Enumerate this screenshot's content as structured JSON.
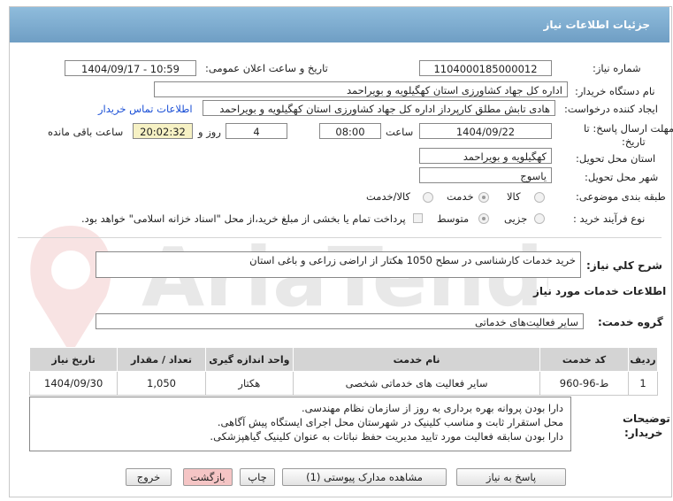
{
  "header": {
    "title": "جزئیات اطلاعات نیاز"
  },
  "need_number": {
    "label": "شماره نیاز:",
    "value": "1104000185000012"
  },
  "announce": {
    "label": "تاریخ و ساعت اعلان عمومی:",
    "value": "1404/09/17 - 10:59"
  },
  "buyer_org": {
    "label": "نام دستگاه خریدار:",
    "value": "اداره کل جهاد کشاورزی استان کهگیلویه و بویراحمد"
  },
  "requester": {
    "label": "ایجاد کننده درخواست:",
    "value": "هادی تابش مطلق کارپرداز اداره کل جهاد کشاورزی استان کهگیلویه و بویراحمد",
    "contact_link": "اطلاعات تماس خریدار"
  },
  "deadline": {
    "label1": "مهلت ارسال پاسخ: تا",
    "label2": "تاریخ:",
    "date": "1404/09/22",
    "time_label": "ساعت",
    "time": "08:00",
    "days": "4",
    "days_label": "روز و",
    "remaining": "20:02:32",
    "remaining_label": "ساعت باقی مانده"
  },
  "province": {
    "label": "استان محل تحویل:",
    "value": "کهگیلویه و بویراحمد"
  },
  "city": {
    "label": "شهر محل تحویل:",
    "value": "یاسوج"
  },
  "category": {
    "label": "طبقه بندی موضوعی:",
    "options": [
      "کالا",
      "خدمت",
      "کالا/خدمت"
    ],
    "selected": "خدمت"
  },
  "process": {
    "label": "نوع فرآیند خرید :",
    "options": [
      "جزیی",
      "متوسط"
    ],
    "selected": "متوسط",
    "payment_note": "پرداخت تمام یا بخشی از مبلغ خرید،از محل \"اسناد خزانه اسلامی\" خواهد بود."
  },
  "summary": {
    "label": "شرح کلي نياز:",
    "value": "خرید خدمات کارشناسی در سطح 1050 هکتار از اراضی زراعی و باغی استان"
  },
  "services_section": {
    "title": "اطلاعات خدمات مورد نیاز"
  },
  "service_group": {
    "label": "گروه خدمت:",
    "value": "سایر فعالیت‌های خدماتی"
  },
  "table": {
    "headers": [
      "ردیف",
      "کد خدمت",
      "نام خدمت",
      "واحد اندازه گیری",
      "تعداد / مقدار",
      "تاریخ نیاز"
    ],
    "rows": [
      [
        "1",
        "ط-96-960",
        "سایر فعالیت های خدماتی شخصی",
        "هکتار",
        "1,050",
        "1404/09/30"
      ]
    ]
  },
  "buyer_notes": {
    "label1": "توضیحات",
    "label2": "خریدار:",
    "lines": [
      "دارا بودن پروانه بهره برداری به روز از سازمان نظام مهندسی.",
      "محل استقرار ثابت و مناسب کلینیک در شهرستان محل اجرای ایستگاه پیش آگاهی.",
      "دارا بودن سابقه فعالیت مورد تایید مدیریت حفظ نباتات به عنوان کلینیک گیاهپزشکی."
    ]
  },
  "buttons": {
    "reply": "پاسخ به نیاز",
    "docs": "مشاهده مدارک پیوستی (1)",
    "print": "چاپ",
    "back": "بازگشت",
    "exit": "خروج"
  },
  "colors": {
    "header_bg": "#7aa7cd",
    "link": "#1a4fd6",
    "remaining_bg": "#f6f1c4",
    "back_btn": "#f5c5c5"
  }
}
